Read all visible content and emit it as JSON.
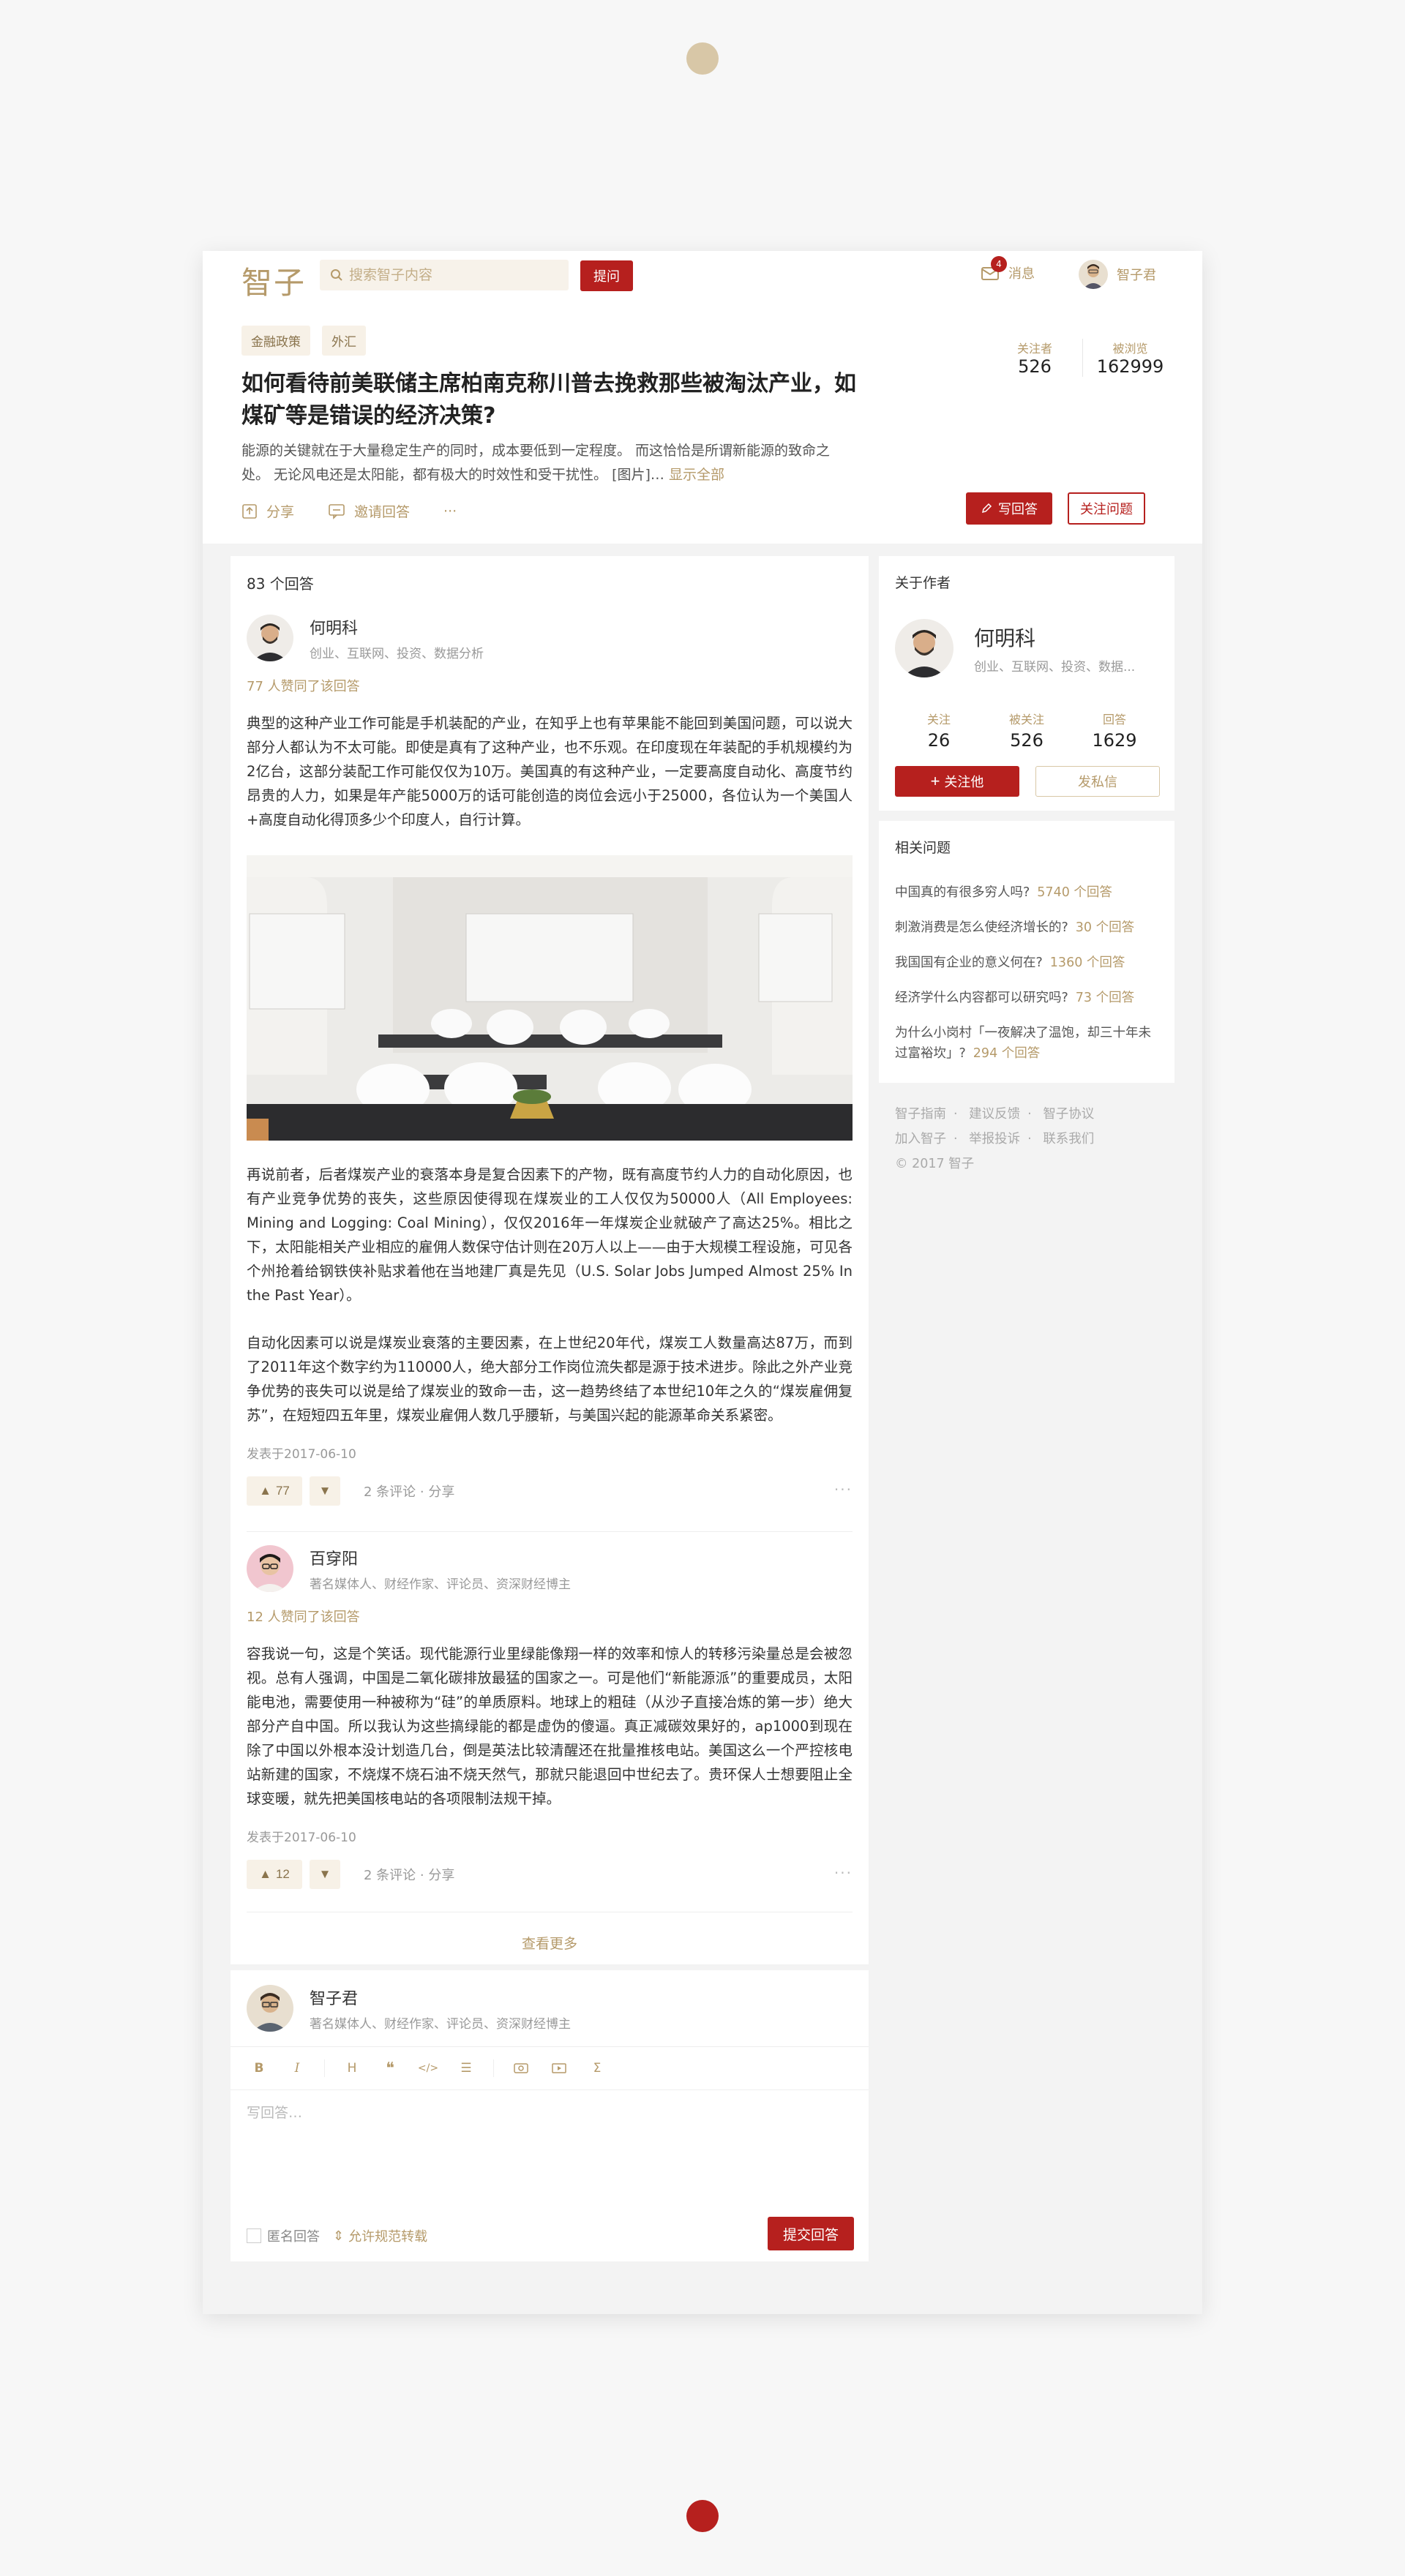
{
  "header": {
    "logo": "智子",
    "search_placeholder": "搜索智子内容",
    "ask_label": "提问",
    "messages_label": "消息",
    "messages_badge": "4",
    "username": "智子君"
  },
  "question": {
    "tags": [
      "金融政策",
      "外汇"
    ],
    "title": "如何看待前美联储主席柏南克称川普去挽救那些被淘汰产业，如煤矿等是错误的经济决策?",
    "description": "能源的关键就在于大量稳定生产的同时，成本要低到一定程度。 而这恰恰是所谓新能源的致命之处。 无论风电还是太阳能，都有极大的时效性和受干扰性。 [图片]… ",
    "show_all": "显示全部",
    "share_label": "分享",
    "invite_label": "邀请回答",
    "more": "···",
    "followers_label": "关注者",
    "followers": "526",
    "views_label": "被浏览",
    "views": "162999",
    "write_answer_label": "写回答",
    "follow_question_label": "关注问题"
  },
  "answers": {
    "count_label": "83 个回答",
    "items": [
      {
        "name": "何明科",
        "bio": "创业、互联网、投资、数据分析",
        "likes": "77 人赞同了该回答",
        "para1": "典型的这种产业工作可能是手机装配的产业，在知乎上也有苹果能不能回到美国问题，可以说大部分人都认为不太可能。即使是真有了这种产业，也不乐观。在印度现在年装配的手机规模约为2亿台，这部分装配工作可能仅仅为10万。美国真的有这种产业，一定要高度自动化、高度节约昂贵的人力，如果是年产能5000万的话可能创造的岗位会远小于25000，各位认为一个美国人+高度自动化得顶多少个印度人，自行计算。",
        "para2": "再说前者，后者煤炭产业的衰落本身是复合因素下的产物，既有高度节约人力的自动化原因，也有产业竞争优势的丧失，这些原因使得现在煤炭业的工人仅仅为50000人（All Employees: Mining and Logging: Coal Mining），仅仅2016年一年煤炭企业就破产了高达25%。相比之下，太阳能相关产业相应的雇佣人数保守估计则在20万人以上——由于大规模工程设施，可见各个州抢着给钢铁侠补贴求着他在当地建厂真是先见（U.S. Solar Jobs Jumped Almost 25% In the Past Year）。",
        "para3": "自动化因素可以说是煤炭业衰落的主要因素，在上世纪20年代，煤炭工人数量高达87万，而到了2011年这个数字约为110000人，绝大部分工作岗位流失都是源于技术进步。除此之外产业竞争优势的丧失可以说是给了煤炭业的致命一击，这一趋势终结了本世纪10年之久的“煤炭雇佣复苏”，在短短四五年里，煤炭业雇佣人数几乎腰斩，与美国兴起的能源革命关系紧密。",
        "date": "发表于2017-06-10",
        "votes": "77",
        "comments": "2 条评论 · 分享",
        "more": "···"
      },
      {
        "name": "百穿阳",
        "bio": "著名媒体人、财经作家、评论员、资深财经博主",
        "likes": "12 人赞同了该回答",
        "para1": "容我说一句，这是个笑话。现代能源行业里绿能像翔一样的效率和惊人的转移污染量总是会被忽视。总有人强调，中国是二氧化碳排放最猛的国家之一。可是他们“新能源派”的重要成员，太阳能电池，需要使用一种被称为“硅”的单质原料。地球上的粗硅（从沙子直接冶炼的第一步）绝大部分产自中国。所以我认为这些搞绿能的都是虚伪的傻逼。真正减碳效果好的，ap1000到现在除了中国以外根本没计划造几台，倒是英法比较清醒还在批量推核电站。美国这么一个严控核电站新建的国家，不烧煤不烧石油不烧天然气，那就只能退回中世纪去了。贵环保人士想要阻止全球变暖，就先把美国核电站的各项限制法规干掉。",
        "date": "发表于2017-06-10",
        "votes": "12",
        "comments": "2 条评论 · 分享",
        "more": "···"
      }
    ],
    "load_more": "查看更多"
  },
  "editor": {
    "name": "智子君",
    "bio": "著名媒体人、财经作家、评论员、资深财经博主",
    "placeholder": "写回答…",
    "anonymous_label": "匿名回答",
    "repost_label": "允许规范转载",
    "submit_label": "提交回答"
  },
  "sidebar": {
    "about_title": "关于作者",
    "author_name": "何明科",
    "author_bio": "创业、互联网、投资、数据...",
    "following_label": "关注",
    "following": "26",
    "followed_label": "被关注",
    "followed": "526",
    "answers_label": "回答",
    "answers": "1629",
    "follow_label": "关注他",
    "dm_label": "发私信",
    "related_title": "相关问题",
    "related": [
      {
        "q": "中国真的有很多穷人吗?",
        "c": "5740 个回答"
      },
      {
        "q": "刺激消费是怎么使经济增长的?",
        "c": "30 个回答"
      },
      {
        "q": "我国国有企业的意义何在?",
        "c": "1360 个回答"
      },
      {
        "q": "经济学什么内容都可以研究吗?",
        "c": "73 个回答"
      },
      {
        "q": "为什么小岗村「一夜解决了温饱，却三十年未过富裕坎」?",
        "c": "294 个回答"
      }
    ],
    "footer": {
      "guide": "智子指南",
      "feedback": "建议反馈",
      "agreement": "智子协议",
      "join": "加入智子",
      "report": "举报投诉",
      "contact": "联系我们",
      "copyright": "© 2017 智子"
    }
  },
  "colors": {
    "brand_red": "#b6201e",
    "brand_gold": "#b59a6a",
    "tag_bg": "#f7f1e7"
  }
}
